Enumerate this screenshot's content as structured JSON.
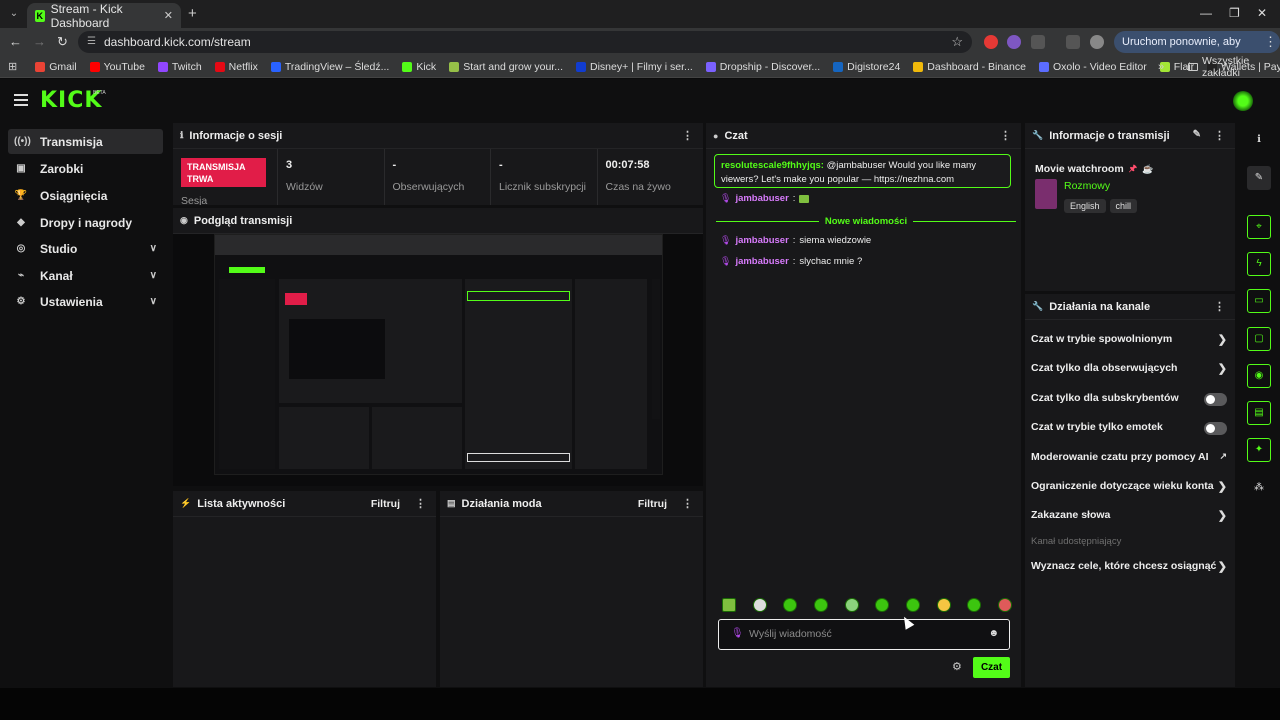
{
  "browser": {
    "tab_title": "Stream - Kick Dashboard",
    "url": "dashboard.kick.com/stream",
    "update_button": "Uruchom ponownie, aby zaktualizować",
    "bookmarks": [
      {
        "label": "Gmail",
        "color": "#ea4335"
      },
      {
        "label": "YouTube",
        "color": "#ff0000"
      },
      {
        "label": "Twitch",
        "color": "#9146ff"
      },
      {
        "label": "Netflix",
        "color": "#e50914"
      },
      {
        "label": "TradingView – Śledź...",
        "color": "#2962ff"
      },
      {
        "label": "Kick",
        "color": "#53fc18"
      },
      {
        "label": "Start and grow your...",
        "color": "#96bf48"
      },
      {
        "label": "Disney+ | Filmy i ser...",
        "color": "#113ccf"
      },
      {
        "label": "Dropship - Discover...",
        "color": "#7b61ff"
      },
      {
        "label": "Digistore24",
        "color": "#1565c0"
      },
      {
        "label": "Dashboard - Binance",
        "color": "#f0b90b"
      },
      {
        "label": "Oxolo - Video Editor",
        "color": "#5b6cff"
      },
      {
        "label": "Flair",
        "color": "#a3e635"
      },
      {
        "label": "Wallets | Paybis",
        "color": "#222222"
      }
    ],
    "all_bookmarks": "Wszystkie zakładki"
  },
  "app": {
    "logo": "KICK",
    "beta": "BETA"
  },
  "sidebar": {
    "items": [
      {
        "label": "Transmisja",
        "icon": "broadcast-icon"
      },
      {
        "label": "Zarobki",
        "icon": "wallet-icon"
      },
      {
        "label": "Osiągnięcia",
        "icon": "trophy-icon"
      },
      {
        "label": "Dropy i nagrody",
        "icon": "gift-icon"
      },
      {
        "label": "Studio",
        "icon": "studio-icon"
      },
      {
        "label": "Kanał",
        "icon": "channel-icon"
      },
      {
        "label": "Ustawienia",
        "icon": "gear-icon"
      }
    ]
  },
  "session": {
    "title": "Informacje o sesji",
    "live_badge": "TRANSMISJA TRWA",
    "session_label": "Sesja",
    "stats": [
      {
        "value": "3",
        "label": "Widzów"
      },
      {
        "value": "-",
        "label": "Obserwujących"
      },
      {
        "value": "-",
        "label": "Licznik subskrypcji"
      },
      {
        "value": "00:07:58",
        "label": "Czas na żywo"
      }
    ]
  },
  "preview": {
    "title": "Podgląd transmisji"
  },
  "activity": {
    "title": "Lista aktywności",
    "filter": "Filtruj"
  },
  "mod_actions": {
    "title": "Działania moda",
    "filter": "Filtruj"
  },
  "chat": {
    "title": "Czat",
    "pinned_user": "resolutescale9fhhyjqs:",
    "pinned_text": "@jambabuser Would you like many viewers? Let's make you popular — https://nezhna.com",
    "new_messages": "Nowe wiadomości",
    "messages": [
      {
        "user": "jambabuser",
        "text": ""
      },
      {
        "user": "jambabuser",
        "text": "siema wiedzowie"
      },
      {
        "user": "jambabuser",
        "text": "slychac mnie ?"
      }
    ],
    "placeholder": "Wyślij wiadomość",
    "send": "Czat"
  },
  "stream_info": {
    "title": "Informacje o transmisji",
    "stream_title": "Movie watchroom",
    "category": "Rozmowy",
    "tags": [
      "English",
      "chill"
    ]
  },
  "channel_actions": {
    "title": "Działania na kanale",
    "items": [
      {
        "label": "Czat w trybie spowolnionym",
        "control": "chevron"
      },
      {
        "label": "Czat tylko dla obserwujących",
        "control": "chevron"
      },
      {
        "label": "Czat tylko dla subskrybentów",
        "control": "toggle"
      },
      {
        "label": "Czat w trybie tylko emotek",
        "control": "toggle"
      },
      {
        "label": "Moderowanie czatu przy pomocy AI",
        "control": "external"
      },
      {
        "label": "Ograniczenie dotyczące wieku konta",
        "control": "chevron"
      },
      {
        "label": "Zakazane słowa",
        "control": "chevron"
      }
    ],
    "shared_channel": "Kanał udostępniający",
    "goals": "Wyznacz cele, które chcesz osiągnąć"
  },
  "colors": {
    "brand": "#53fc18",
    "live": "#e11d48",
    "username": "#d77bfb"
  }
}
